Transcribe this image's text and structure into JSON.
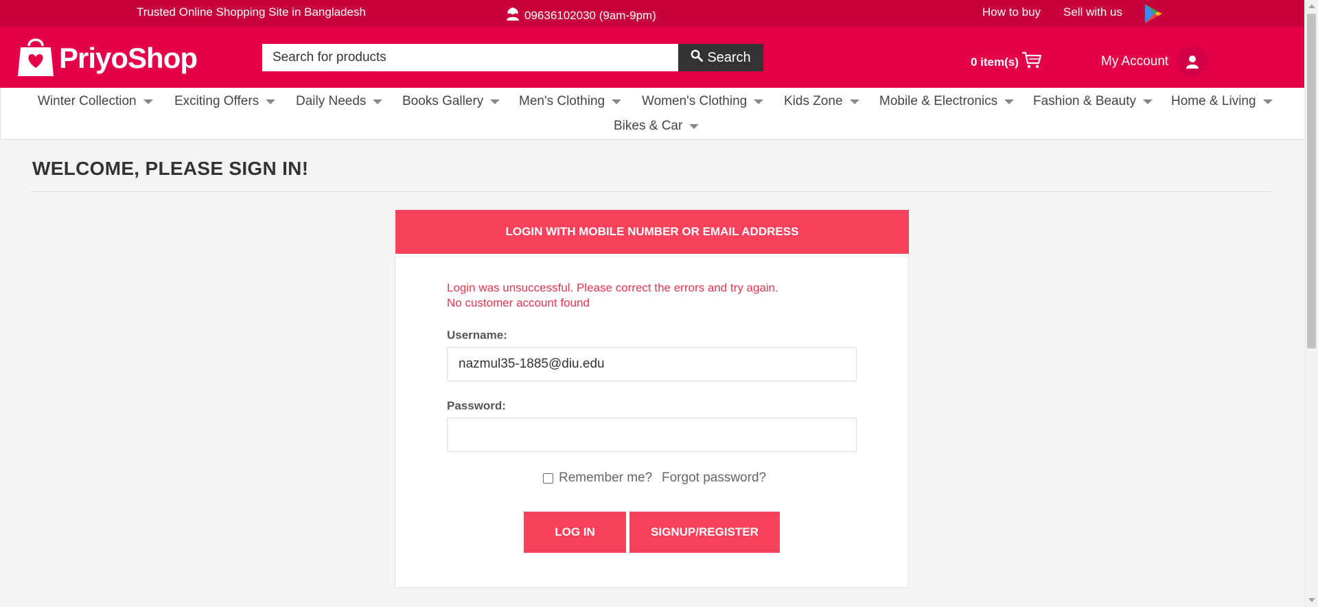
{
  "topbar": {
    "tagline": "Trusted Online Shopping Site in Bangladesh",
    "phone": "09636102030 (9am-9pm)",
    "how_to_buy": "How to buy",
    "sell_with_us": "Sell with us"
  },
  "header": {
    "logo_text": "PriyoShop",
    "search_placeholder": "Search for products",
    "search_button": "Search",
    "cart_label": "0 item(s)",
    "account_label": "My Account"
  },
  "nav": {
    "items": [
      {
        "label": "Winter Collection"
      },
      {
        "label": "Exciting Offers"
      },
      {
        "label": "Daily Needs"
      },
      {
        "label": "Books Gallery"
      },
      {
        "label": "Men's Clothing"
      },
      {
        "label": "Women's Clothing"
      },
      {
        "label": "Kids Zone"
      },
      {
        "label": "Mobile & Electronics"
      },
      {
        "label": "Fashion & Beauty"
      },
      {
        "label": "Home & Living"
      },
      {
        "label": "Bikes & Car"
      }
    ]
  },
  "main": {
    "title": "WELCOME, PLEASE SIGN IN!",
    "card_title": "LOGIN WITH MOBILE NUMBER OR EMAIL ADDRESS",
    "error_line1": "Login was unsuccessful. Please correct the errors and try again.",
    "error_line2": "No customer account found",
    "username_label": "Username:",
    "username_value": "nazmul35-1885@diu.edu",
    "password_label": "Password:",
    "password_value": "",
    "remember_label": "Remember me?",
    "remember_checked": false,
    "forgot_label": "Forgot password?",
    "login_button": "LOG IN",
    "register_button": "SIGNUP/REGISTER"
  },
  "colors": {
    "topbar": "#c8003c",
    "header": "#e5004a",
    "accent": "#f9415c",
    "error": "#e8344f"
  },
  "icons": [
    "support-agent-icon",
    "google-play-icon",
    "shopping-bag-heart-icon",
    "search-icon",
    "cart-icon",
    "user-icon",
    "chevron-down-icon"
  ]
}
